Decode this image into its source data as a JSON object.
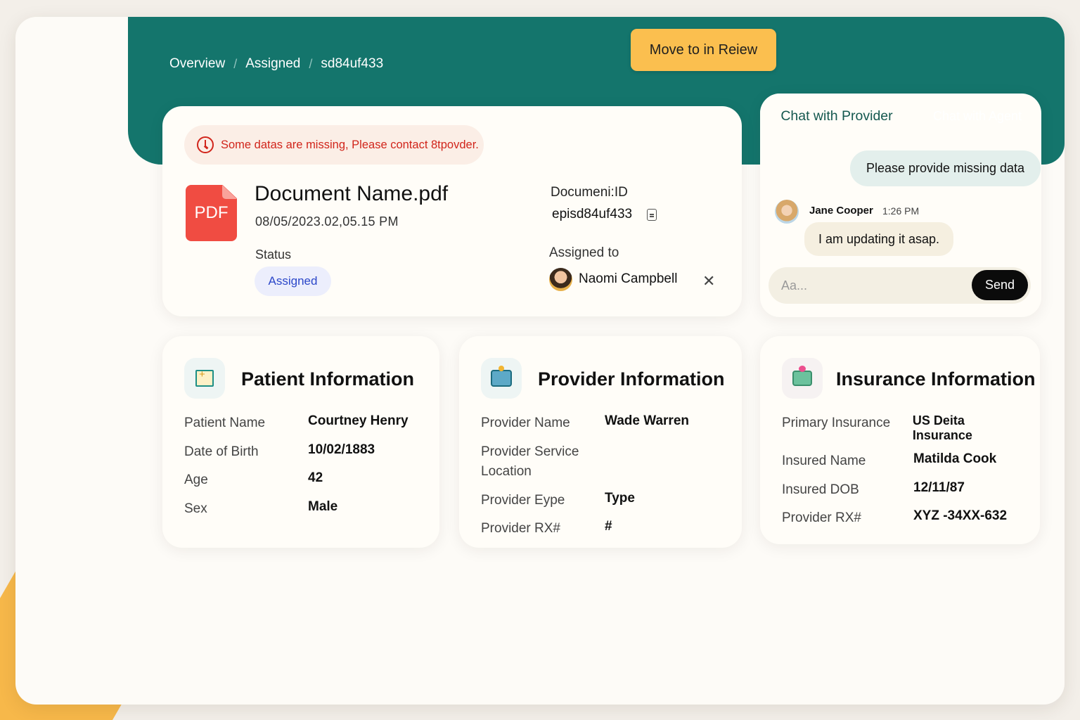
{
  "breadcrumb": {
    "items": [
      "Overview",
      "Assigned",
      "sd84uf433"
    ],
    "separator": "/"
  },
  "toolbar": {
    "move_label": "Move to in Reiew"
  },
  "document": {
    "alert": "Some datas are missing, Please contact 8tpovder.",
    "file_icon_label": "PDF",
    "name": "Document Name.pdf",
    "datetime": "08/05/2023.02,05.15 PM",
    "status_label": "Status",
    "status_value": "Assigned",
    "doc_id_label": "Documeni:ID",
    "doc_id_value": "episd84uf433",
    "assigned_label": "Assigned to",
    "assignee": "Naomi Campbell",
    "remove_glyph": "✕"
  },
  "chat": {
    "tabs": [
      {
        "label": "Chat with Provider",
        "active": true
      },
      {
        "label": "Chat with Agent",
        "active": false
      }
    ],
    "messages": [
      {
        "direction": "out",
        "text": "Please provide missing data"
      },
      {
        "direction": "in",
        "sender": "Jane Cooper",
        "time": "1:26 PM",
        "text": "I am updating it asap."
      }
    ],
    "input_placeholder": "Aa...",
    "send_label": "Send"
  },
  "patient": {
    "title": "Patient Information",
    "icon": "patient-card-icon",
    "rows": [
      {
        "label": "Patient Name",
        "value": "Courtney Henry"
      },
      {
        "label": "Date of Birth",
        "value": "10/02/1883"
      },
      {
        "label": "Age",
        "value": "42"
      },
      {
        "label": "Sex",
        "value": "Male"
      }
    ]
  },
  "provider": {
    "title": "Provider Information",
    "icon": "hospital-icon",
    "rows": [
      {
        "label": "Provider Name",
        "value": "Wade Warren"
      },
      {
        "label": "Provider Service Location",
        "value": ""
      },
      {
        "label": "Provider Eype",
        "value": "Type"
      },
      {
        "label": "Provider RX#",
        "value": "#"
      }
    ]
  },
  "insurance": {
    "title": "Insurance Information",
    "icon": "insurance-icon",
    "rows": [
      {
        "label": "Primary Insurance",
        "value": "US Deita Insurance"
      },
      {
        "label": "Insured Name",
        "value": "Matilda Cook"
      },
      {
        "label": "Insured DOB",
        "value": "12/11/87"
      },
      {
        "label": "Provider RX#",
        "value": "XYZ -34XX-632"
      }
    ]
  },
  "colors": {
    "teal": "#14756c",
    "accent_yellow": "#fbbf4f",
    "alert_red": "#d1251b",
    "status_blue": "#2b47c9",
    "pdf_red": "#f04c42"
  }
}
